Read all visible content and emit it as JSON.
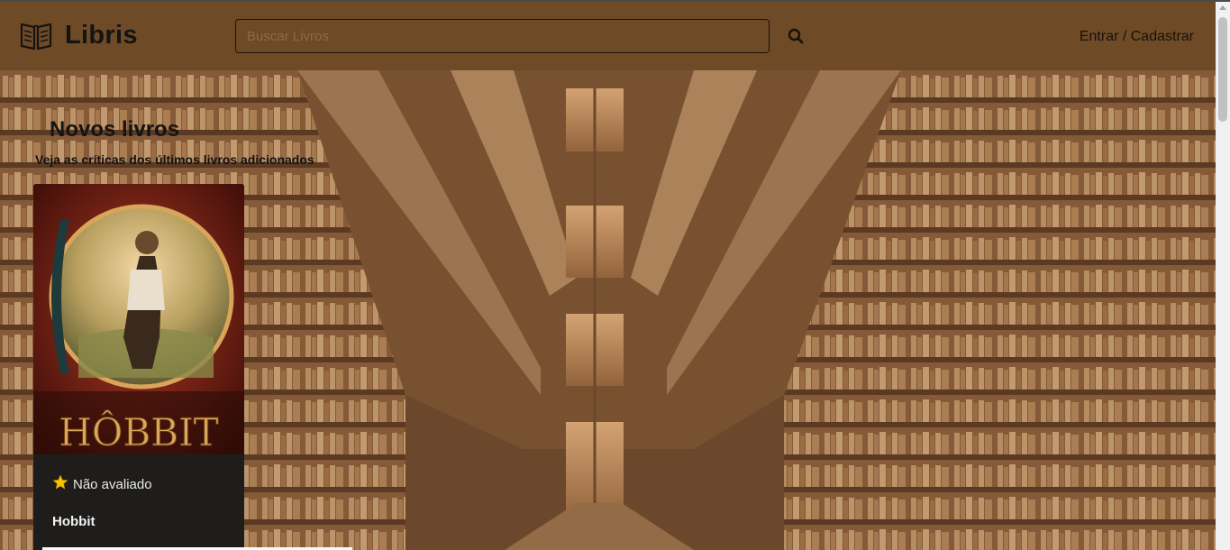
{
  "navbar": {
    "brand": "Libris",
    "search_placeholder": "Buscar Livros",
    "auth_link": "Entrar / Cadastrar"
  },
  "icons": {
    "brand": "open-book-icon",
    "search": "search-icon",
    "rating": "star-icon"
  },
  "section": {
    "title": "Novos livros",
    "subtitle": "Veja as críticas dos últimos livros adicionados"
  },
  "books": [
    {
      "cover_text": "HÔBBIT",
      "rating": "Não avaliado",
      "title": "Hobbit"
    }
  ],
  "colors": {
    "navbar": "#6e4a26",
    "card": "#1f1d1b",
    "star": "#f5c400"
  }
}
